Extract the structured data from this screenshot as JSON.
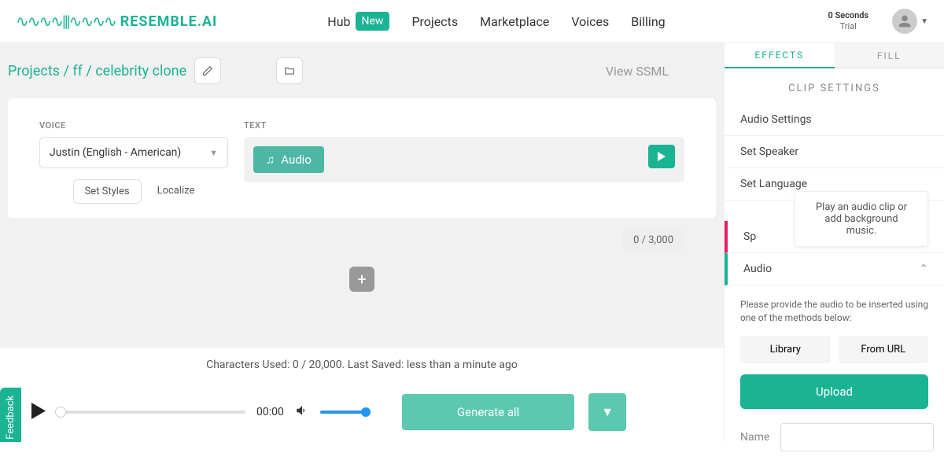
{
  "header": {
    "logo_text": "RESEMBLE.AI",
    "nav": {
      "hub": "Hub",
      "hub_badge": "New",
      "projects": "Projects",
      "marketplace": "Marketplace",
      "voices": "Voices",
      "billing": "Billing"
    },
    "trial": {
      "line1": "0 Seconds",
      "line2": "Trial"
    }
  },
  "breadcrumb": "Projects / ff / celebrity clone",
  "view_ssml": "View SSML",
  "voice": {
    "label": "VOICE",
    "selected": "Justin (English - American)",
    "set_styles": "Set Styles",
    "localize": "Localize"
  },
  "text": {
    "label": "TEXT",
    "chip": "Audio",
    "count": "0 / 3,000"
  },
  "stats": "Characters Used: 0 / 20,000. Last Saved: less than a minute ago",
  "player": {
    "time": "00:00",
    "generate": "Generate all"
  },
  "feedback": "Feedback",
  "right": {
    "tabs": {
      "effects": "EFFECTS",
      "fill": "FILL"
    },
    "title": "CLIP SETTINGS",
    "items": {
      "audio_settings": "Audio Settings",
      "set_speaker": "Set Speaker",
      "set_language": "Set Language",
      "sp": "Sp",
      "audio": "Audio"
    },
    "tooltip": "Play an audio clip or add background music.",
    "audio_desc": "Please provide the audio to be inserted using one of the methods below:",
    "library": "Library",
    "from_url": "From URL",
    "upload": "Upload",
    "name_label": "Name"
  }
}
